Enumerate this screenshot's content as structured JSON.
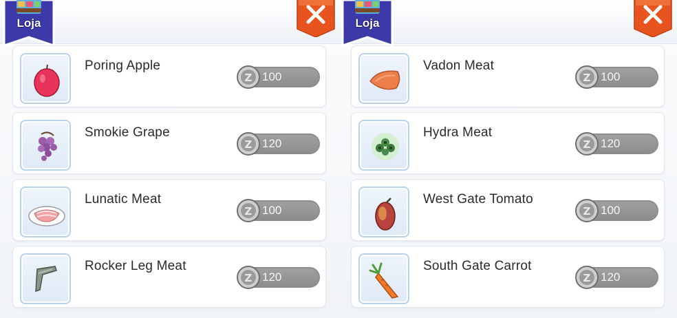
{
  "panels": [
    {
      "banner_label": "Loja",
      "items": [
        {
          "name": "Poring Apple",
          "price": "100",
          "icon": "apple-icon"
        },
        {
          "name": "Smokie Grape",
          "price": "120",
          "icon": "grape-icon"
        },
        {
          "name": "Lunatic Meat",
          "price": "100",
          "icon": "meat-plate-icon"
        },
        {
          "name": "Rocker Leg Meat",
          "price": "120",
          "icon": "leg-meat-icon"
        }
      ]
    },
    {
      "banner_label": "Loja",
      "items": [
        {
          "name": "Vadon Meat",
          "price": "100",
          "icon": "vadon-meat-icon"
        },
        {
          "name": "Hydra Meat",
          "price": "120",
          "icon": "hydra-meat-icon"
        },
        {
          "name": "West Gate Tomato",
          "price": "100",
          "icon": "tomato-icon"
        },
        {
          "name": "South Gate Carrot",
          "price": "120",
          "icon": "carrot-icon"
        }
      ]
    }
  ],
  "colors": {
    "close_button": "#e8541f",
    "banner": "#3b3aa8",
    "price_pill": "#959597",
    "thumb_border": "#b9d2ec"
  },
  "icons": {
    "currency": "zeny-coin-icon",
    "close": "close-icon",
    "shop": "shop-banner-icon"
  }
}
